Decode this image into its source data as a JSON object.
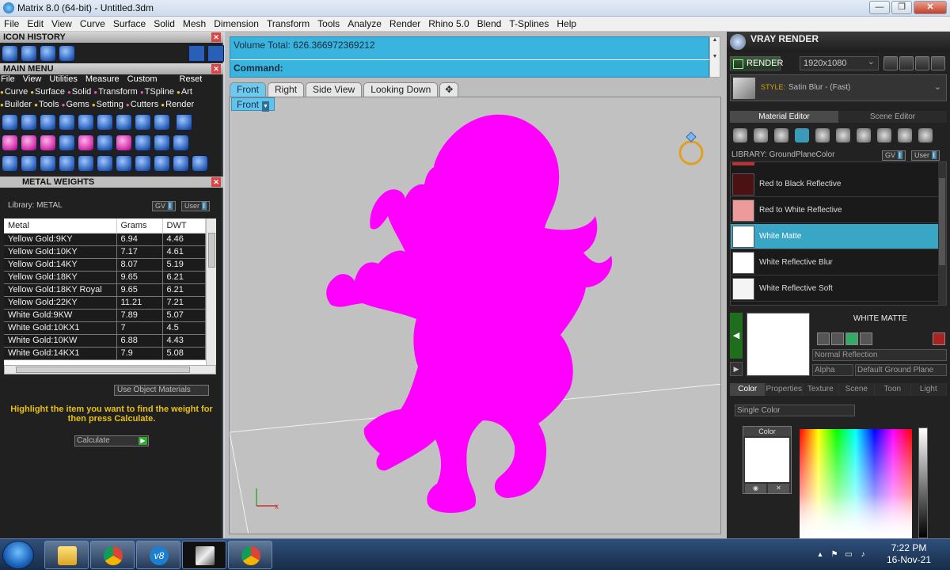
{
  "window": {
    "title": "Matrix 8.0 (64-bit) - Untitled.3dm"
  },
  "menubar": [
    "File",
    "Edit",
    "View",
    "Curve",
    "Surface",
    "Solid",
    "Mesh",
    "Dimension",
    "Transform",
    "Tools",
    "Analyze",
    "Render",
    "Rhino 5.0",
    "Blend",
    "T-Splines",
    "Help"
  ],
  "icon_history": {
    "title": "ICON HISTORY"
  },
  "main_menu": {
    "title": "MAIN MENU",
    "menu": [
      "File",
      "View",
      "Utilities",
      "Measure",
      "Custom"
    ],
    "reset": "Reset",
    "row1": [
      "Curve",
      "Surface",
      "Solid",
      "Transform",
      "TSpline",
      "Art"
    ],
    "row2": [
      "Builder",
      "Tools",
      "Gems",
      "Setting",
      "Cutters",
      "Render"
    ]
  },
  "metal_weights": {
    "title": "METAL WEIGHTS",
    "library": "Library: METAL",
    "gv": "GV",
    "user": "User",
    "columns": [
      "Metal",
      "Grams",
      "DWT"
    ],
    "rows": [
      [
        "Yellow Gold:9KY",
        "6.94",
        "4.46"
      ],
      [
        "Yellow Gold:10KY",
        "7.17",
        "4.61"
      ],
      [
        "Yellow Gold:14KY",
        "8.07",
        "5.19"
      ],
      [
        "Yellow Gold:18KY",
        "9.65",
        "6.21"
      ],
      [
        "Yellow Gold:18KY Royal",
        "9.65",
        "6.21"
      ],
      [
        "Yellow Gold:22KY",
        "11.21",
        "7.21"
      ],
      [
        "White Gold:9KW",
        "7.89",
        "5.07"
      ],
      [
        "White Gold:10KX1",
        "7",
        "4.5"
      ],
      [
        "White Gold:10KW",
        "6.88",
        "4.43"
      ],
      [
        "White Gold:14KX1",
        "7.9",
        "5.08"
      ]
    ],
    "use_object": "Use Object Materials",
    "hint": "Highlight the item you want to find the weight for then press Calculate.",
    "calculate": "Calculate"
  },
  "command": {
    "volume_line": "Volume Total: 626.366972369212",
    "prompt": "Command:"
  },
  "viewport_tabs": [
    "Front",
    "Right",
    "Side View",
    "Looking Down"
  ],
  "active_viewport": "Front",
  "vray": {
    "title": "VRAY RENDER",
    "render": "RENDER",
    "resolution": "1920x1080",
    "style_label": "STYLE:",
    "style_value": "Satin Blur - (Fast)",
    "tabs": [
      "Material Editor",
      "Scene Editor"
    ],
    "library": "LIBRARY: GroundPlaneColor",
    "materials": [
      {
        "name": "Red to Black Reflective",
        "color": "#4a1212"
      },
      {
        "name": "Red to White Reflective",
        "color": "#ec9a9a"
      },
      {
        "name": "White Matte",
        "color": "#ffffff"
      },
      {
        "name": "White Reflective Blur",
        "color": "#ffffff"
      },
      {
        "name": "White Reflective Soft",
        "color": "#f4f4f4"
      }
    ],
    "selected_material": "WHITE MATTE",
    "normal_reflection": "Normal Reflection",
    "alpha": "Alpha",
    "default_ground_plane": "Default Ground Plane",
    "prop_tabs": [
      "Color",
      "Properties",
      "Texture",
      "Scene",
      "Toon",
      "Light"
    ],
    "single_color": "Single Color",
    "color_label": "Color"
  },
  "taskbar": {
    "time": "7:22 PM",
    "date": "16-Nov-21"
  },
  "colors": {
    "accent": "#38b4df",
    "object": "#ff00ff"
  }
}
